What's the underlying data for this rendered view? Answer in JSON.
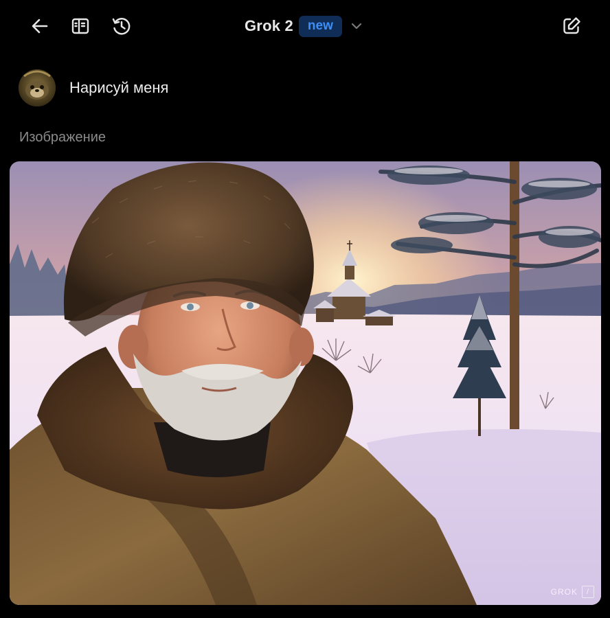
{
  "header": {
    "model_name": "Grok 2",
    "badge": "new",
    "icons": {
      "back": "arrow-left-icon",
      "sidebar": "sidebar-panel-icon",
      "history": "history-clock-icon",
      "new_chat": "edit-new-chat-icon",
      "model_dropdown": "chevron-down-icon"
    }
  },
  "conversation": {
    "user_message": "Нарисуй меня",
    "response_label": "Изображение",
    "image": {
      "watermark": "GROK",
      "watermark_icon": "grok-logo-icon"
    }
  },
  "colors": {
    "background": "#000000",
    "badge_bg": "#0f2d57",
    "badge_text": "#3d8ff5",
    "label_gray": "#8b8b8b"
  }
}
